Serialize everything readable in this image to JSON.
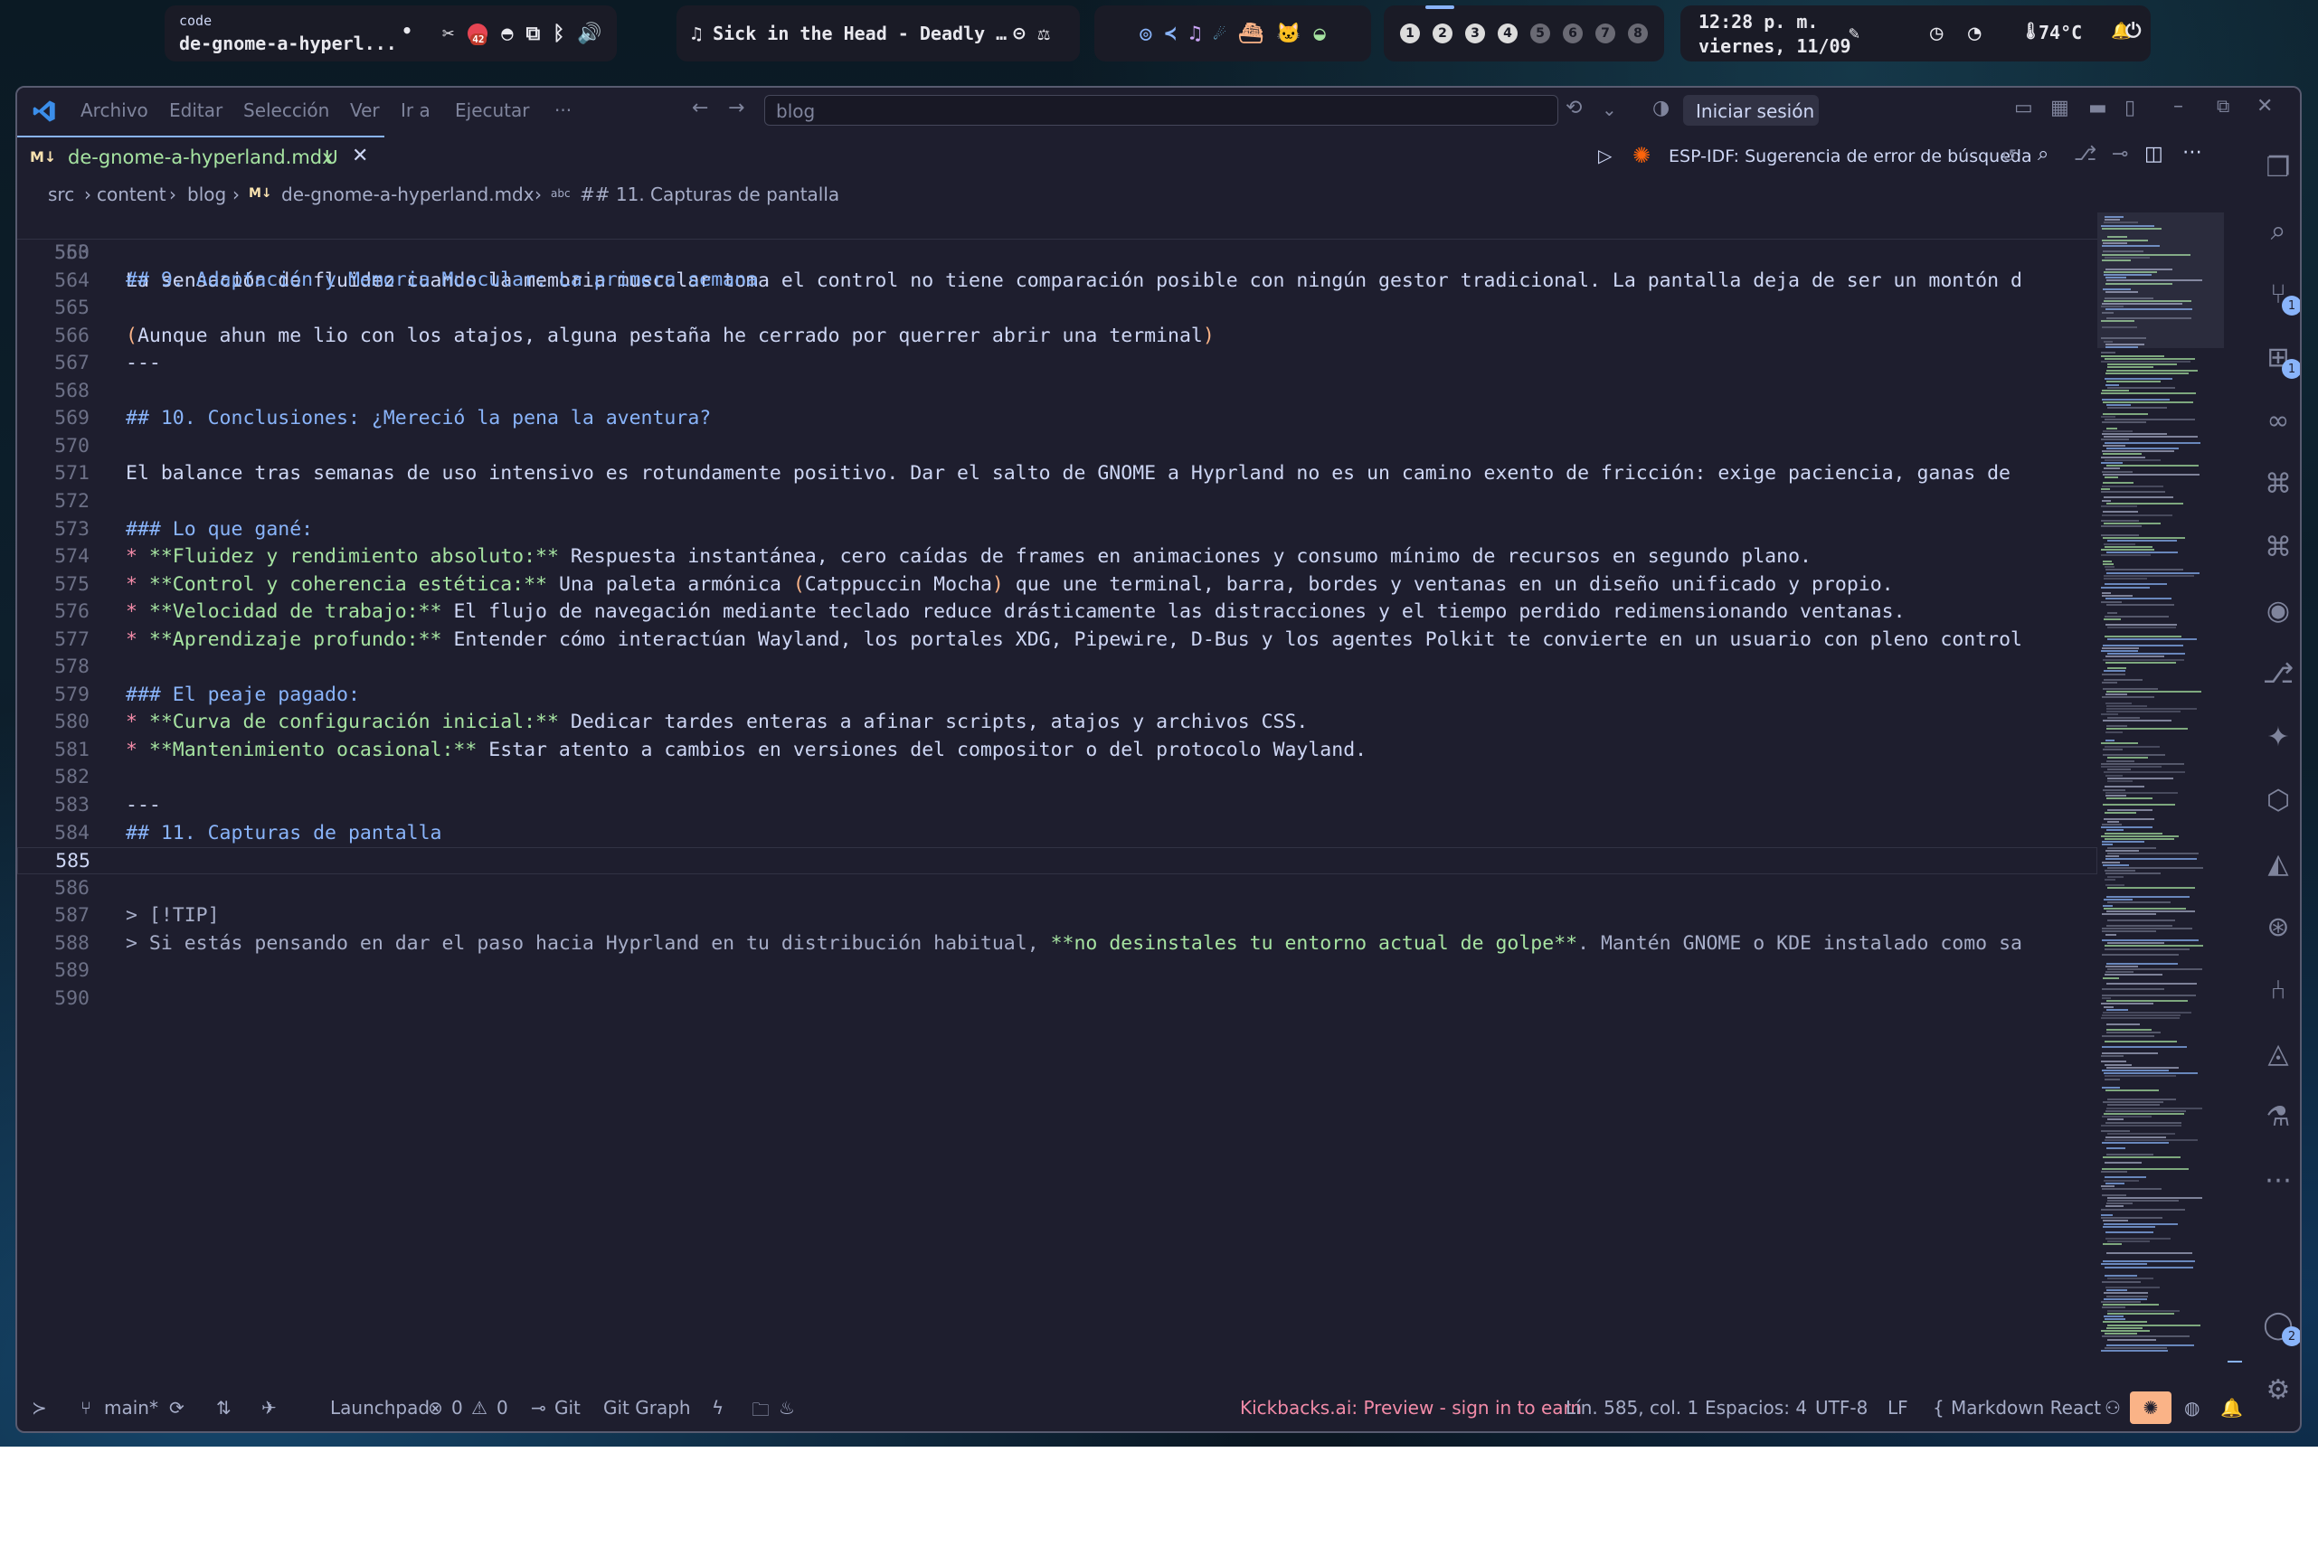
{
  "waybar": {
    "window_app": "code",
    "window_title": "de-gnome-a-hyperl...",
    "dot": "•",
    "tray_badge": "42",
    "media_title": "♫ Sick in the Head - Deadly …",
    "workspaces": [
      "1",
      "2",
      "3",
      "4",
      "5",
      "6",
      "7",
      "8"
    ],
    "active_workspace": "2",
    "time": "12:28 p. m.",
    "date": "viernes, 11/09",
    "temperature": "74°C"
  },
  "titlebar": {
    "menu": [
      "Archivo",
      "Editar",
      "Selección",
      "Ver",
      "Ir a",
      "Ejecutar",
      "···"
    ],
    "search": "blog",
    "signin": "Iniciar sesión"
  },
  "tab": {
    "label": "de-gnome-a-hyperland.mdx",
    "status": "U",
    "editor_action": "ESP-IDF: Sugerencia de error de búsqueda"
  },
  "breadcrumb": [
    "src",
    "content",
    "blog",
    "de-gnome-a-hyperland.mdx",
    "## 11. Capturas de pantalla"
  ],
  "editor": {
    "sticky": {
      "num": "550",
      "text": "## 9. Adaptación y Memoria Muscular: La primera semana"
    },
    "lines": [
      {
        "num": "563",
        "segments": []
      },
      {
        "num": "564",
        "segments": [
          {
            "t": "La sensación de fluidez cuando la memoria muscular toma el control no tiene comparación posible con ningún gestor tradicional. La pantalla deja de ser un montón d",
            "c": ""
          }
        ]
      },
      {
        "num": "565",
        "segments": []
      },
      {
        "num": "566",
        "segments": [
          {
            "t": "(",
            "c": "paren"
          },
          {
            "t": "Aunque ahun me lio con los atajos, alguna pestaña he cerrado por querrer abrir una terminal",
            "c": ""
          },
          {
            "t": ")",
            "c": "paren"
          }
        ]
      },
      {
        "num": "567",
        "segments": [
          {
            "t": "---",
            "c": ""
          }
        ]
      },
      {
        "num": "568",
        "segments": []
      },
      {
        "num": "569",
        "segments": [
          {
            "t": "## 10. Conclusiones: ¿Mereció la pena la aventura?",
            "c": "h"
          }
        ]
      },
      {
        "num": "570",
        "segments": []
      },
      {
        "num": "571",
        "segments": [
          {
            "t": "El balance tras semanas de uso intensivo es rotundamente positivo. Dar el salto de GNOME a Hyprland no es un camino exento de fricción: exige paciencia, ganas de",
            "c": ""
          }
        ]
      },
      {
        "num": "572",
        "segments": []
      },
      {
        "num": "573",
        "segments": [
          {
            "t": "### Lo que gané:",
            "c": "h"
          }
        ]
      },
      {
        "num": "574",
        "segments": [
          {
            "t": "* ",
            "c": "bullet"
          },
          {
            "t": "**Fluidez y rendimiento absoluto:**",
            "c": "bold"
          },
          {
            "t": " Respuesta instantánea, cero caídas de frames en animaciones y consumo mínimo de recursos en segundo plano.",
            "c": ""
          }
        ]
      },
      {
        "num": "575",
        "segments": [
          {
            "t": "* ",
            "c": "bullet"
          },
          {
            "t": "**Control y coherencia estética:**",
            "c": "bold"
          },
          {
            "t": " Una paleta armónica ",
            "c": ""
          },
          {
            "t": "(",
            "c": "paren"
          },
          {
            "t": "Catppuccin Mocha",
            "c": ""
          },
          {
            "t": ")",
            "c": "paren"
          },
          {
            "t": " que une terminal, barra, bordes y ventanas en un diseño unificado y propio.",
            "c": ""
          }
        ]
      },
      {
        "num": "576",
        "segments": [
          {
            "t": "* ",
            "c": "bullet"
          },
          {
            "t": "**Velocidad de trabajo:**",
            "c": "bold"
          },
          {
            "t": " El flujo de navegación mediante teclado reduce drásticamente las distracciones y el tiempo perdido redimensionando ventanas.",
            "c": ""
          }
        ]
      },
      {
        "num": "577",
        "segments": [
          {
            "t": "* ",
            "c": "bullet"
          },
          {
            "t": "**Aprendizaje profundo:**",
            "c": "bold"
          },
          {
            "t": " Entender cómo interactúan Wayland, los portales XDG, Pipewire, D-Bus y los agentes Polkit te convierte en un usuario con pleno control",
            "c": ""
          }
        ]
      },
      {
        "num": "578",
        "segments": []
      },
      {
        "num": "579",
        "segments": [
          {
            "t": "### El peaje pagado:",
            "c": "h"
          }
        ]
      },
      {
        "num": "580",
        "segments": [
          {
            "t": "* ",
            "c": "bullet"
          },
          {
            "t": "**Curva de configuración inicial:**",
            "c": "bold"
          },
          {
            "t": " Dedicar tardes enteras a afinar scripts, atajos y archivos CSS.",
            "c": ""
          }
        ]
      },
      {
        "num": "581",
        "segments": [
          {
            "t": "* ",
            "c": "bullet"
          },
          {
            "t": "**Mantenimiento ocasional:**",
            "c": "bold"
          },
          {
            "t": " Estar atento a cambios en versiones del compositor o del protocolo Wayland.",
            "c": ""
          }
        ]
      },
      {
        "num": "582",
        "segments": []
      },
      {
        "num": "583",
        "segments": [
          {
            "t": "---",
            "c": ""
          }
        ]
      },
      {
        "num": "584",
        "segments": [
          {
            "t": "## 11. Capturas de pantalla",
            "c": "h"
          }
        ]
      },
      {
        "num": "585",
        "segments": []
      },
      {
        "num": "586",
        "segments": []
      },
      {
        "num": "587",
        "segments": [
          {
            "t": "> [!TIP]",
            "c": "quote"
          }
        ]
      },
      {
        "num": "588",
        "segments": [
          {
            "t": "> Si estás pensando en dar el paso hacia Hyprland en tu distribución habitual, ",
            "c": "quote"
          },
          {
            "t": "**no desinstales tu entorno actual de golpe**",
            "c": "bold"
          },
          {
            "t": ". Mantén GNOME o KDE instalado como sa",
            "c": "quote"
          }
        ]
      },
      {
        "num": "589",
        "segments": []
      },
      {
        "num": "590",
        "segments": []
      }
    ]
  },
  "activity_badges": {
    "source_control": "1",
    "extensions": "1",
    "accounts": "2"
  },
  "statusbar": {
    "branch": "main*",
    "launchpad": "Launchpad",
    "errors": "0",
    "warnings": "0",
    "git": "Git",
    "git_graph": "Git Graph",
    "kickbacks": "Kickbacks.ai: Preview - sign in to earn",
    "position": "Lín. 585, col. 1",
    "spaces": "Espacios: 4",
    "encoding": "UTF-8",
    "eol": "LF",
    "language": "Markdown React"
  },
  "colors": {
    "editor_bg": "#1e1e2e",
    "heading": "#89b4fa",
    "bold": "#a6e3a1",
    "bullet": "#f38ba8",
    "paren": "#fab387",
    "kickbacks": "#f38ba8",
    "modified_file": "#a6e3a1"
  }
}
